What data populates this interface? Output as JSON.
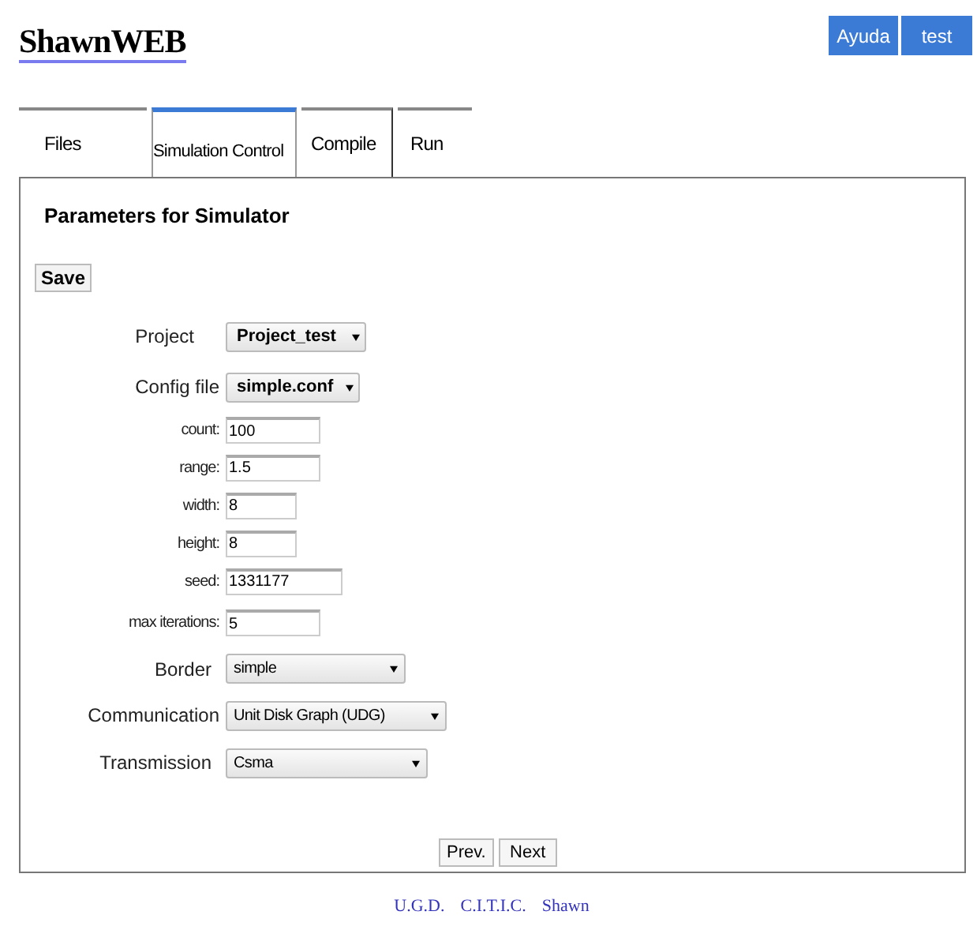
{
  "header": {
    "logo": "ShawnWEB",
    "buttons": [
      "Ayuda",
      "test"
    ]
  },
  "tabs": [
    {
      "label": "Files",
      "selected": false
    },
    {
      "label": "Simulation Control",
      "selected": true
    },
    {
      "label": "Compile",
      "selected": false
    },
    {
      "label": "Run",
      "selected": false
    }
  ],
  "panel": {
    "title": "Parameters for Simulator",
    "save_button": "Save",
    "fields": [
      {
        "kind": "project-select",
        "label": "Project",
        "value": "Project_test"
      },
      {
        "kind": "project-select",
        "label": "Config file",
        "value": "simple.conf"
      },
      {
        "kind": "text",
        "label": "count:",
        "value": "100"
      },
      {
        "kind": "text",
        "label": "range:",
        "value": "1.5"
      },
      {
        "kind": "text",
        "label": "width:",
        "value": "8"
      },
      {
        "kind": "text",
        "label": "height:",
        "value": "8"
      },
      {
        "kind": "text",
        "label": "seed:",
        "value": "1331177"
      },
      {
        "kind": "text",
        "label": "max iterations:",
        "value": "5"
      },
      {
        "kind": "select",
        "label": "Border",
        "value": "simple"
      },
      {
        "kind": "select",
        "label": "Communication",
        "value": "Unit Disk Graph (UDG)"
      },
      {
        "kind": "select",
        "label": "Transmission",
        "value": "Csma"
      }
    ],
    "nav_buttons": [
      "Prev.",
      "Next"
    ]
  },
  "footer": {
    "links": [
      "U.G.D.",
      "C.I.T.I.C.",
      "Shawn"
    ]
  }
}
